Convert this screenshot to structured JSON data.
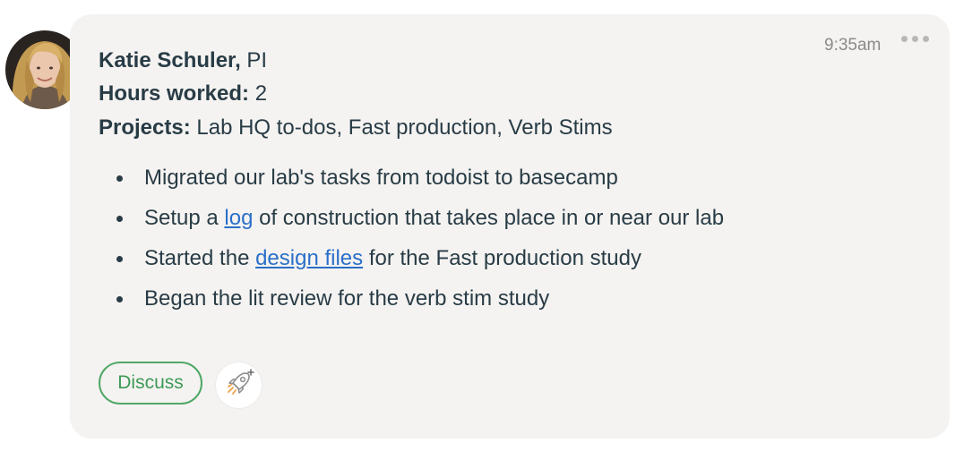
{
  "post": {
    "timestamp": "9:35am",
    "author_name": "Katie Schuler,",
    "author_role": "PI",
    "hours_label": "Hours worked:",
    "hours_value": "2",
    "projects_label": "Projects:",
    "projects_value": "Lab HQ to-dos, Fast production, Verb Stims",
    "bullets": [
      {
        "text": "Migrated our lab's tasks from todoist to basecamp"
      },
      {
        "before": "Setup a ",
        "link": "log",
        "after": " of construction that takes place in or near our lab"
      },
      {
        "before": "Started the ",
        "link": "design files",
        "after": " for the Fast production study"
      },
      {
        "text": "Began the lit review for the verb stim study"
      }
    ]
  },
  "actions": {
    "discuss_label": "Discuss",
    "boost_icon": "rocket-boost-icon",
    "more_icon": "more-options-icon"
  },
  "colors": {
    "card_background": "#f5f3f1",
    "text": "#283c46",
    "link": "#2a6fc9",
    "discuss_green": "#3d9a58"
  }
}
